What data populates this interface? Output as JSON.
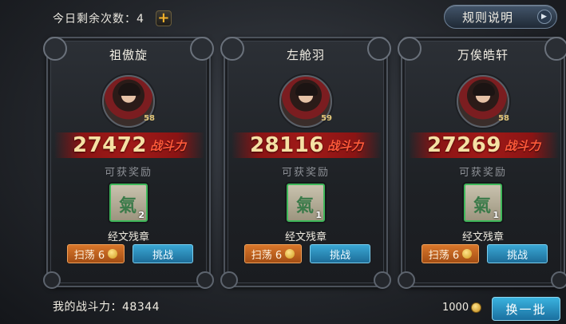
{
  "header": {
    "remaining_label": "今日剩余次数：4",
    "add_symbol": "+",
    "rules_label": "规则说明",
    "rules_arrow": "▶"
  },
  "opponents": [
    {
      "name": "祖傲旋",
      "level": "58",
      "power": "27472",
      "power_tag": "战斗力",
      "reward_label": "可获奖励",
      "reward_item": "经文残章",
      "reward_count": "2",
      "reward_glyph": "氣",
      "sweep_label": "扫荡 6",
      "challenge_label": "挑战"
    },
    {
      "name": "左舱羽",
      "level": "59",
      "power": "28116",
      "power_tag": "战斗力",
      "reward_label": "可获奖励",
      "reward_item": "经文残章",
      "reward_count": "1",
      "reward_glyph": "氣",
      "sweep_label": "扫荡 6",
      "challenge_label": "挑战"
    },
    {
      "name": "万俟皓轩",
      "level": "58",
      "power": "27269",
      "power_tag": "战斗力",
      "reward_label": "可获奖励",
      "reward_item": "经文残章",
      "reward_count": "1",
      "reward_glyph": "氣",
      "sweep_label": "扫荡 6",
      "challenge_label": "挑战"
    }
  ],
  "footer": {
    "my_power_label": "我的战斗力：48344",
    "gold": "1000",
    "refresh_label": "换一批"
  },
  "colors": {
    "accent_gold": "#f2b12a",
    "power_red_band": "#a11a18",
    "sweep_orange": "#d9772b",
    "challenge_blue": "#3aa7d4"
  },
  "icons": [
    "plus-icon",
    "arrow-right-icon",
    "hero-avatar",
    "scripture-item-icon",
    "coin-icon"
  ]
}
